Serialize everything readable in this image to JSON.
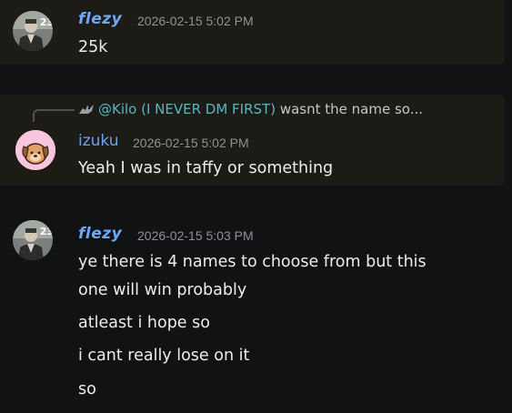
{
  "messages": [
    {
      "author": "flezy",
      "timestamp": "2026-02-15 5:02 PM",
      "lines": [
        "25k"
      ],
      "avatar_badge": "23"
    },
    {
      "author": "izuku",
      "timestamp": "2026-02-15 5:02 PM",
      "lines": [
        "Yeah I was in taffy or something"
      ],
      "reply": {
        "mention": "@Kilo (I NEVER DM FIRST)",
        "text": "wasnt the name so..."
      }
    },
    {
      "author": "flezy",
      "timestamp": "2026-02-15 5:03 PM",
      "lines": [
        "ye there is 4 names to choose from but this",
        "one will win probably",
        "atleast i hope so",
        "i cant really lose on it",
        "so"
      ],
      "avatar_badge": "23"
    }
  ],
  "colors": {
    "background": "#111214",
    "highlight": "#1c1b16",
    "username": "#6fa9f5",
    "mention": "#56b7c3"
  },
  "icons": {
    "reply_author_icon": "dragon-avatar-icon"
  }
}
